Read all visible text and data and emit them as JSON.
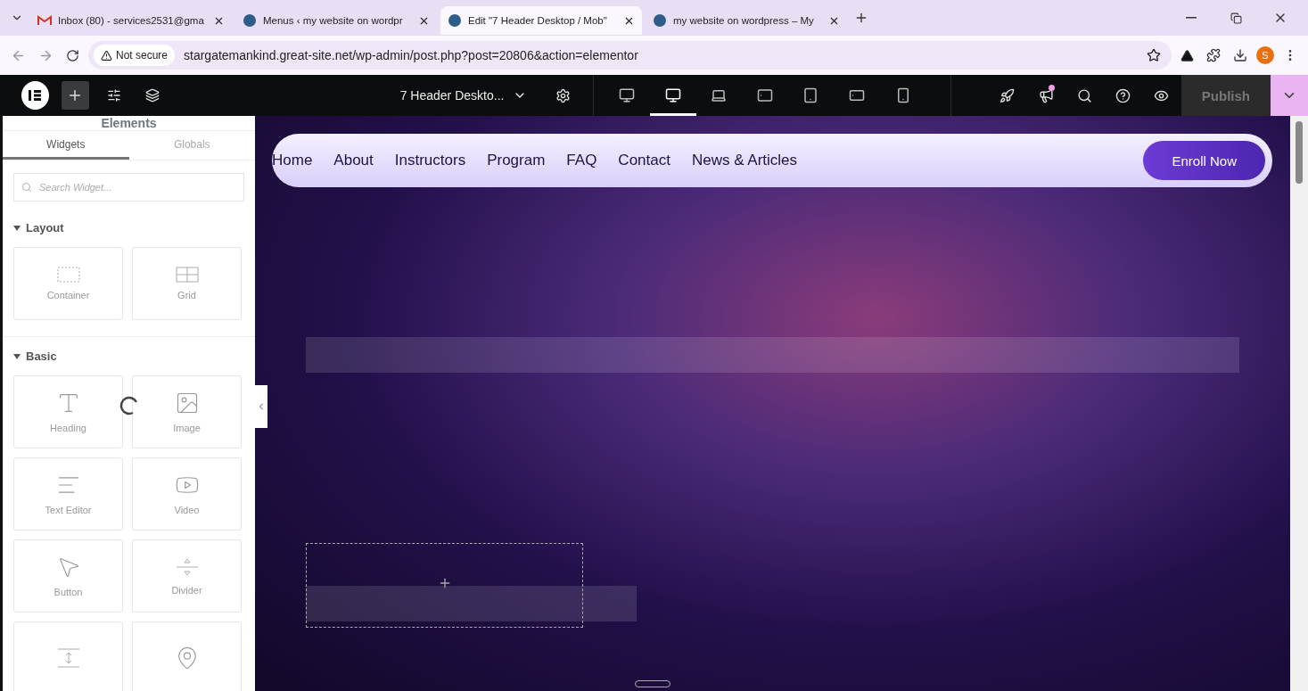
{
  "browser": {
    "tabs": [
      {
        "title": "Inbox (80) - services2531@gma",
        "selected": false
      },
      {
        "title": "Menus ‹ my website on wordpr",
        "selected": false
      },
      {
        "title": "Edit \"7 Header Desktop / Mob\"",
        "selected": true
      },
      {
        "title": "my website on wordpress – My",
        "selected": false
      }
    ],
    "security": "Not secure",
    "url": "stargatemankind.great-site.net/wp-admin/post.php?post=20806&action=elementor",
    "profile": "S"
  },
  "toolbar": {
    "document_title": "7 Header Deskto...",
    "devices": [
      {
        "kind": "desktop",
        "selected": false
      },
      {
        "kind": "laptop-wide",
        "selected": true
      },
      {
        "kind": "laptop",
        "selected": false
      },
      {
        "kind": "tablet-landscape",
        "selected": false
      },
      {
        "kind": "tablet",
        "selected": false
      },
      {
        "kind": "mobile-landscape",
        "selected": false
      },
      {
        "kind": "mobile",
        "selected": false
      }
    ],
    "notification": true,
    "publish": "Publish"
  },
  "panel": {
    "title": "Elements",
    "tabs": [
      {
        "label": "Widgets",
        "selected": true
      },
      {
        "label": "Globals",
        "selected": false
      }
    ],
    "search": {
      "placeholder": "Search Widget..."
    },
    "loading": true,
    "sections": [
      {
        "title": "Layout",
        "expanded": true,
        "widgets": [
          {
            "kind": "container",
            "label": "Container"
          },
          {
            "kind": "grid",
            "label": "Grid"
          }
        ]
      },
      {
        "title": "Basic",
        "expanded": true,
        "widgets": [
          {
            "kind": "heading",
            "label": "Heading"
          },
          {
            "kind": "image",
            "label": "Image"
          },
          {
            "kind": "text",
            "label": "Text Editor"
          },
          {
            "kind": "video",
            "label": "Video"
          },
          {
            "kind": "button",
            "label": "Button"
          },
          {
            "kind": "divider",
            "label": "Divider"
          },
          {
            "kind": "spacer"
          },
          {
            "kind": "map"
          }
        ]
      }
    ]
  },
  "preview": {
    "menu": [
      "Home",
      "About",
      "Instructors",
      "Program",
      "FAQ",
      "Contact",
      "News & Articles"
    ],
    "cta": "Enroll Now"
  }
}
